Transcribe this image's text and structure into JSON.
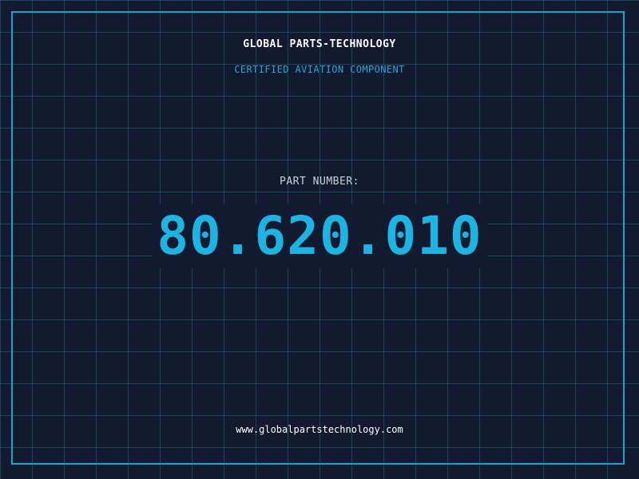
{
  "header": {
    "company_name": "GLOBAL PARTS-TECHNOLOGY",
    "tagline": "CERTIFIED AVIATION COMPONENT"
  },
  "part": {
    "label": "PART NUMBER:",
    "number": "80.620.010"
  },
  "footer": {
    "website": "www.globalpartstechnology.com"
  },
  "colors": {
    "background": "#111a2e",
    "grid": "#26788f",
    "accent": "#1bb5e4",
    "text": "#ffffff"
  }
}
